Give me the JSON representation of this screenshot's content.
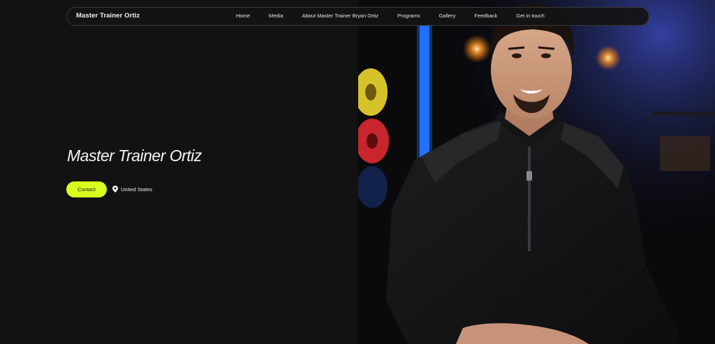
{
  "nav": {
    "brand": "Master Trainer Ortiz",
    "links": [
      "Home",
      "Media",
      "About Master Trainer Bryan Ortiz",
      "Programs",
      "Gallery",
      "Feedback",
      "Get in touch"
    ]
  },
  "hero": {
    "title": "Master Trainer Ortiz",
    "contact_label": "Contact",
    "location": "United States",
    "location_icon": "map-pin-icon",
    "photo_subject": "trainer-portrait"
  },
  "colors": {
    "background": "#121212",
    "accent": "#d9ff1f",
    "text": "#f4f4f4"
  }
}
